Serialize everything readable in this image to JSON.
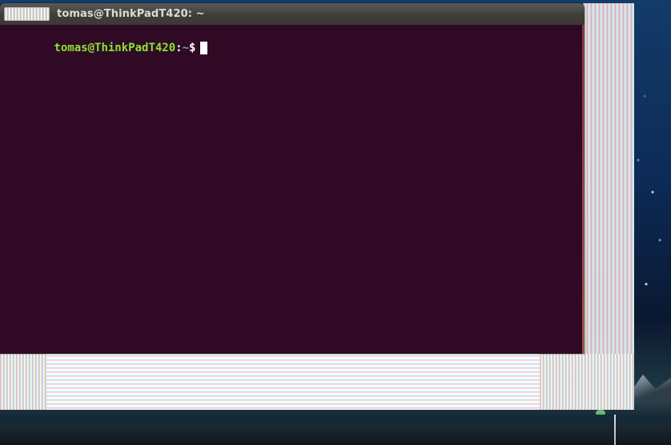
{
  "window": {
    "title": "tomas@ThinkPadT420: ~"
  },
  "terminal": {
    "prompt": {
      "user_host": "tomas@ThinkPadT420",
      "colon": ":",
      "cwd": "~",
      "dollar": "$"
    },
    "colors": {
      "background": "#300a24",
      "user_host": "#8ae234",
      "cwd": "#729fcf",
      "text": "#ffffff"
    }
  }
}
